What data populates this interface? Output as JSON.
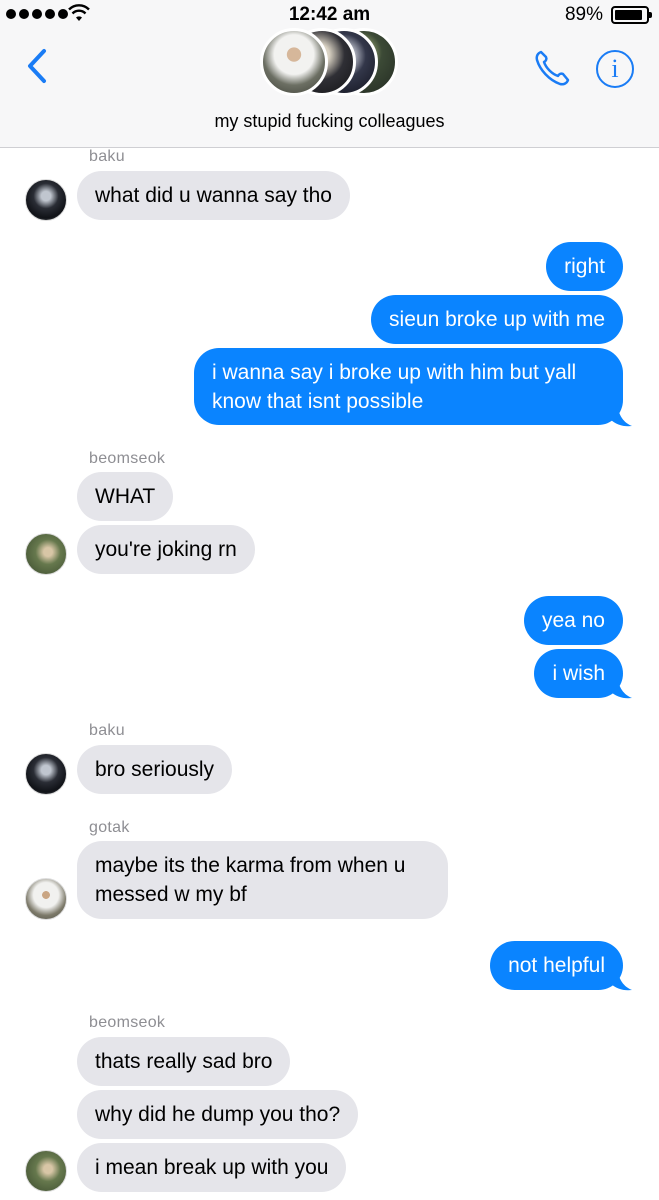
{
  "status_bar": {
    "time": "12:42 am",
    "battery": "89%",
    "battery_level": 0.89,
    "signal_icon": "signal-dots-icon",
    "wifi_icon": "wifi-icon"
  },
  "header": {
    "title": "my stupid fucking colleagues",
    "back_icon": "chevron-left-icon",
    "call_icon": "phone-icon",
    "info_icon": "info-icon",
    "info_glyph": "i",
    "accent_color": "#1a7cf5"
  },
  "messages": {
    "sender_baku_1": "baku",
    "m1": "what did u wanna say tho",
    "m2": "right",
    "m3": "sieun broke up with me",
    "m4": "i wanna say i broke up with him but yall know that isnt possible",
    "sender_beomseok_1": "beomseok",
    "m5": "WHAT",
    "m6": "you're joking rn",
    "m7": "yea no",
    "m8": "i wish",
    "sender_baku_2": "baku",
    "m9": "bro seriously",
    "sender_gotak": "gotak",
    "m10": "maybe its the karma from when u messed w my bf",
    "m11": "not helpful",
    "sender_beomseok_2": "beomseok",
    "m12": "thats really sad bro",
    "m13": "why did he dump you tho?",
    "m14": "i mean break up with you"
  },
  "colors": {
    "outgoing_bubble": "#0a84ff",
    "incoming_bubble": "#e5e5ea",
    "sender_name": "#8e8e93"
  }
}
